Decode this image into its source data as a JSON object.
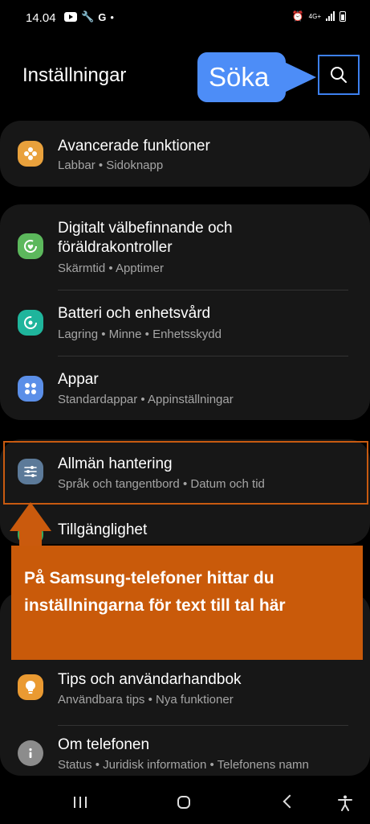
{
  "status_bar": {
    "time": "14.04",
    "network": "4G+"
  },
  "header": {
    "title": "Inställningar"
  },
  "annotations": {
    "search_callout": "Söka",
    "samsung_note": "På Samsung-telefoner hittar du inställningarna för text till tal här"
  },
  "items": {
    "advanced": {
      "title": "Avancerade funktioner",
      "subtitle": "Labbar  •  Sidoknapp"
    },
    "wellbeing": {
      "title_line1": "Digitalt välbefinnande och",
      "title_line2": "föräldrakontroller",
      "subtitle": "Skärmtid  •  Apptimer"
    },
    "battery": {
      "title": "Batteri och enhetsvård",
      "subtitle": "Lagring  •  Minne  •  Enhetsskydd"
    },
    "apps": {
      "title": "Appar",
      "subtitle": "Standardappar  •  Appinställningar"
    },
    "general": {
      "title": "Allmän hantering",
      "subtitle": "Språk och tangentbord  •  Datum och tid"
    },
    "accessibility": {
      "title": "Tillgänglighet"
    },
    "tips": {
      "title": "Tips och användarhandbok",
      "subtitle": "Användbara tips  •  Nya funktioner"
    },
    "about": {
      "title": "Om telefonen",
      "subtitle": "Status  •  Juridisk information  •  Telefonens namn"
    }
  },
  "colors": {
    "advanced_icon": "#e9a13c",
    "wellbeing_icon": "#5cb85c",
    "battery_icon": "#1fb59c",
    "apps_icon": "#5b8fe8",
    "general_icon": "#5c7a99",
    "tips_icon": "#ea9a32",
    "about_icon": "#8c8c8c",
    "callout_blue": "#4d8df7",
    "callout_orange": "#c95a0a"
  }
}
